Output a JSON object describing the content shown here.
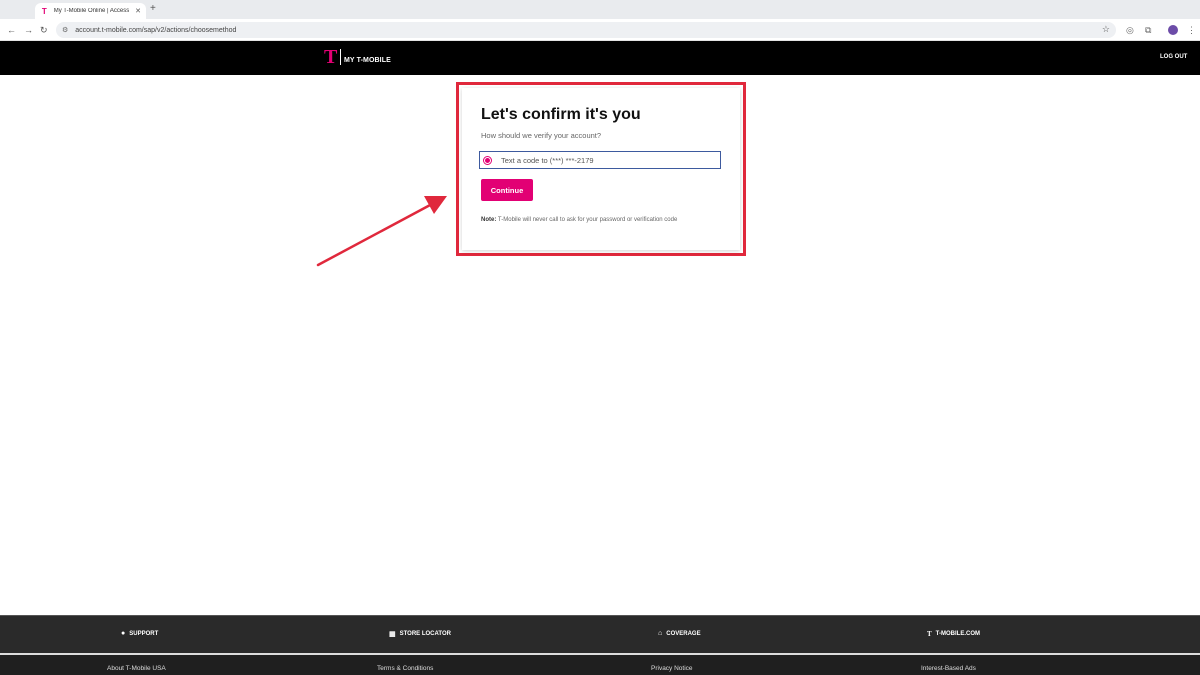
{
  "browser": {
    "tab_title": "My T-Mobile Online | Access",
    "tab_favicon": "T",
    "tab_close": "✕",
    "new_tab": "+",
    "back": "←",
    "forward": "→",
    "reload": "↻",
    "url": "account.t-mobile.com/sap/v2/actions/choosemethod",
    "icons": [
      "site-info-icon",
      "bookmark-star-icon",
      "extension-icon",
      "extensions-puzzle-icon",
      "profile-avatar",
      "menu-kebab-icon"
    ]
  },
  "header": {
    "logo_mark": "T",
    "logo_text": "MY T-MOBILE",
    "logout": "LOG OUT"
  },
  "card": {
    "title": "Let's confirm it's you",
    "subtitle": "How should we verify your account?",
    "option_label": "Text a code to (***) ***-2179",
    "option_selected": true,
    "continue_label": "Continue",
    "note_label": "Note:",
    "note_text": "T-Mobile will never call to ask for your password or verification code"
  },
  "footer": {
    "links": [
      {
        "icon": "support-icon",
        "label": "SUPPORT"
      },
      {
        "icon": "store-icon",
        "label": "STORE LOCATOR"
      },
      {
        "icon": "coverage-icon",
        "label": "COVERAGE"
      },
      {
        "icon": "tmobile-logo-icon",
        "label": "T-MOBILE.COM"
      }
    ],
    "bottom_links": [
      "About T-Mobile USA",
      "Terms & Conditions",
      "Privacy Notice",
      "Interest-Based Ads"
    ]
  },
  "colors": {
    "brand_magenta": "#e20074",
    "highlight_red": "#e0283c",
    "header_bg": "#000000",
    "footer_bg": "#2a2a2a"
  }
}
